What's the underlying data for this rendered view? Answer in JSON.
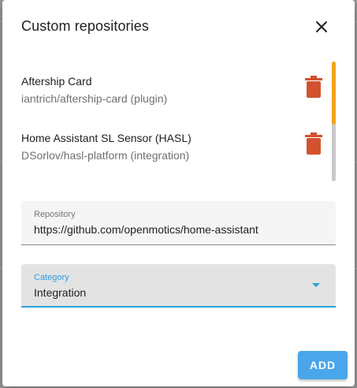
{
  "dialog": {
    "title": "Custom repositories"
  },
  "repositories": [
    {
      "name": "Aftership Card",
      "subtitle": "iantrich/aftership-card (plugin)"
    },
    {
      "name": "Home Assistant SL Sensor (HASL)",
      "subtitle": "DSorlov/hasl-platform (integration)"
    }
  ],
  "form": {
    "repository": {
      "label": "Repository",
      "value": "https://github.com/openmotics/home-assistant"
    },
    "category": {
      "label": "Category",
      "value": "Integration"
    }
  },
  "actions": {
    "add_label": "ADD"
  },
  "icons": {
    "close": "close-icon",
    "delete": "trash-icon",
    "dropdown": "arrow-drop-down-icon"
  },
  "colors": {
    "accent": "#2d9ee0",
    "scrollbar_thumb": "#f4a41f",
    "delete_icon": "#d2522f",
    "add_button": "#4aa6ea"
  }
}
